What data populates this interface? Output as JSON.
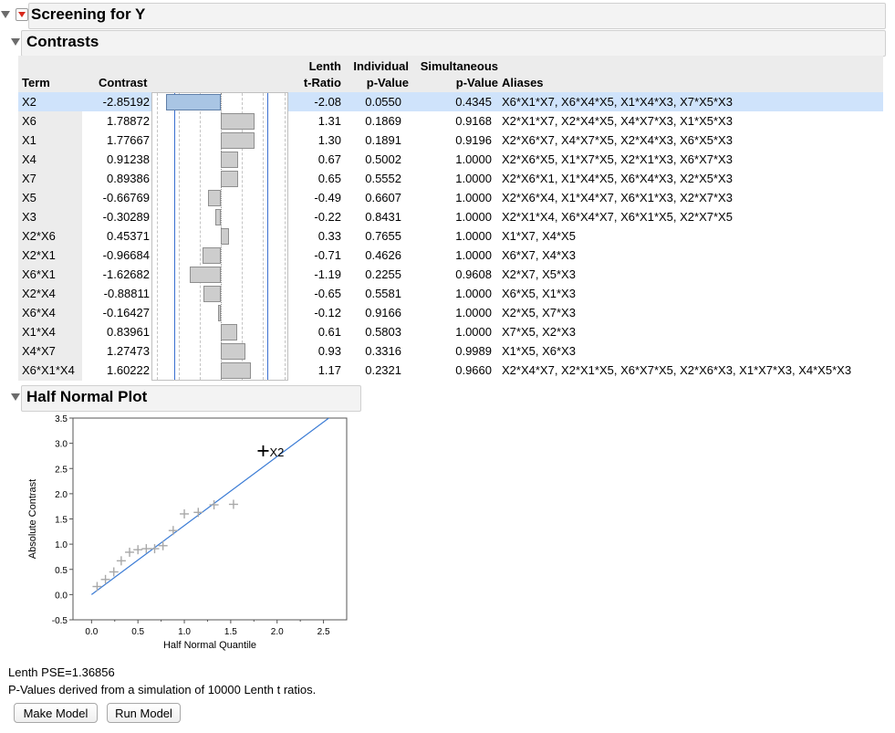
{
  "screening": {
    "title": "Screening for Y"
  },
  "contrasts": {
    "title": "Contrasts",
    "headers": {
      "term": "Term",
      "contrast": "Contrast",
      "lenth_top": "Lenth",
      "lenth_bottom": "t-Ratio",
      "indiv_top": "Individual",
      "indiv_bottom": "p-Value",
      "simul_top": "Simultaneous",
      "simul_bottom": "p-Value",
      "aliases": "Aliases"
    },
    "rows": [
      {
        "term": "X2",
        "contrast": "-2.85192",
        "contrast_value": -2.85192,
        "t": "-2.08",
        "p": "0.0550",
        "sp": "0.4345",
        "aliases": "X6*X1*X7, X6*X4*X5, X1*X4*X3, X7*X5*X3",
        "selected": true
      },
      {
        "term": "X6",
        "contrast": "1.78872",
        "contrast_value": 1.78872,
        "t": "1.31",
        "p": "0.1869",
        "sp": "0.9168",
        "aliases": "X2*X1*X7, X2*X4*X5, X4*X7*X3, X1*X5*X3"
      },
      {
        "term": "X1",
        "contrast": "1.77667",
        "contrast_value": 1.77667,
        "t": "1.30",
        "p": "0.1891",
        "sp": "0.9196",
        "aliases": "X2*X6*X7, X4*X7*X5, X2*X4*X3, X6*X5*X3"
      },
      {
        "term": "X4",
        "contrast": "0.91238",
        "contrast_value": 0.91238,
        "t": "0.67",
        "p": "0.5002",
        "sp": "1.0000",
        "aliases": "X2*X6*X5, X1*X7*X5, X2*X1*X3, X6*X7*X3"
      },
      {
        "term": "X7",
        "contrast": "0.89386",
        "contrast_value": 0.89386,
        "t": "0.65",
        "p": "0.5552",
        "sp": "1.0000",
        "aliases": "X2*X6*X1, X1*X4*X5, X6*X4*X3, X2*X5*X3"
      },
      {
        "term": "X5",
        "contrast": "-0.66769",
        "contrast_value": -0.66769,
        "t": "-0.49",
        "p": "0.6607",
        "sp": "1.0000",
        "aliases": "X2*X6*X4, X1*X4*X7, X6*X1*X3, X2*X7*X3"
      },
      {
        "term": "X3",
        "contrast": "-0.30289",
        "contrast_value": -0.30289,
        "t": "-0.22",
        "p": "0.8431",
        "sp": "1.0000",
        "aliases": "X2*X1*X4, X6*X4*X7, X6*X1*X5, X2*X7*X5"
      },
      {
        "term": "X2*X6",
        "contrast": "0.45371",
        "contrast_value": 0.45371,
        "t": "0.33",
        "p": "0.7655",
        "sp": "1.0000",
        "aliases": "X1*X7, X4*X5"
      },
      {
        "term": "X2*X1",
        "contrast": "-0.96684",
        "contrast_value": -0.96684,
        "t": "-0.71",
        "p": "0.4626",
        "sp": "1.0000",
        "aliases": "X6*X7, X4*X3"
      },
      {
        "term": "X6*X1",
        "contrast": "-1.62682",
        "contrast_value": -1.62682,
        "t": "-1.19",
        "p": "0.2255",
        "sp": "0.9608",
        "aliases": "X2*X7, X5*X3"
      },
      {
        "term": "X2*X4",
        "contrast": "-0.88811",
        "contrast_value": -0.88811,
        "t": "-0.65",
        "p": "0.5581",
        "sp": "1.0000",
        "aliases": "X6*X5, X1*X3"
      },
      {
        "term": "X6*X4",
        "contrast": "-0.16427",
        "contrast_value": -0.16427,
        "t": "-0.12",
        "p": "0.9166",
        "sp": "1.0000",
        "aliases": "X2*X5, X7*X3"
      },
      {
        "term": "X1*X4",
        "contrast": "0.83961",
        "contrast_value": 0.83961,
        "t": "0.61",
        "p": "0.5803",
        "sp": "1.0000",
        "aliases": "X7*X5, X2*X3"
      },
      {
        "term": "X4*X7",
        "contrast": "1.27473",
        "contrast_value": 1.27473,
        "t": "0.93",
        "p": "0.3316",
        "sp": "0.9989",
        "aliases": "X1*X5, X6*X3"
      },
      {
        "term": "X6*X1*X4",
        "contrast": "1.60222",
        "contrast_value": 1.60222,
        "t": "1.17",
        "p": "0.2321",
        "sp": "0.9660",
        "aliases": "X2*X4*X7, X2*X1*X5, X6*X7*X5, X2*X6*X3, X1*X7*X3, X4*X5*X3"
      }
    ]
  },
  "half_normal": {
    "title": "Half Normal Plot"
  },
  "chart_data": {
    "type": "scatter",
    "xlabel": "Half Normal Quantile",
    "ylabel": "Absolute Contrast",
    "xlim": [
      -0.2,
      2.75
    ],
    "ylim": [
      -0.5,
      3.5
    ],
    "xticks": [
      "0.0",
      "0.5",
      "1.0",
      "1.5",
      "2.0",
      "2.5"
    ],
    "xtick_values": [
      0,
      0.5,
      1,
      1.5,
      2,
      2.5
    ],
    "yticks": [
      "-0.5",
      "0.0",
      "0.5",
      "1.0",
      "1.5",
      "2.0",
      "2.5",
      "3.0",
      "3.5"
    ],
    "ytick_values": [
      -0.5,
      0,
      0.5,
      1,
      1.5,
      2,
      2.5,
      3,
      3.5
    ],
    "points": [
      {
        "x": 0.06,
        "y": 0.16
      },
      {
        "x": 0.15,
        "y": 0.3
      },
      {
        "x": 0.24,
        "y": 0.45
      },
      {
        "x": 0.32,
        "y": 0.67
      },
      {
        "x": 0.41,
        "y": 0.84
      },
      {
        "x": 0.5,
        "y": 0.89
      },
      {
        "x": 0.59,
        "y": 0.91
      },
      {
        "x": 0.68,
        "y": 0.91
      },
      {
        "x": 0.77,
        "y": 0.97
      },
      {
        "x": 0.88,
        "y": 1.27
      },
      {
        "x": 1.0,
        "y": 1.6
      },
      {
        "x": 1.15,
        "y": 1.63
      },
      {
        "x": 1.32,
        "y": 1.78
      },
      {
        "x": 1.53,
        "y": 1.79
      },
      {
        "x": 1.85,
        "y": 2.85
      }
    ],
    "labeled_point": {
      "index": 14,
      "label": "X2"
    },
    "reference_line": {
      "x0": 0,
      "y0": 0,
      "slope": 1.36856
    },
    "colors": {
      "point": "#a8a8a8",
      "highlight": "#000000",
      "line": "#3a7bd5"
    }
  },
  "footer": {
    "pse": "Lenth PSE=1.36856",
    "note": "P-Values derived from a simulation of 10000 Lenth t ratios.",
    "make_model": "Make Model",
    "run_model": "Run Model"
  },
  "bars": {
    "max_abs_contrast": 2.85192,
    "margin_line_value": 2.09,
    "colors": {
      "bar": "#cdcdcd",
      "selected": "#a9c5e4",
      "line": "#3a6fd0"
    }
  }
}
